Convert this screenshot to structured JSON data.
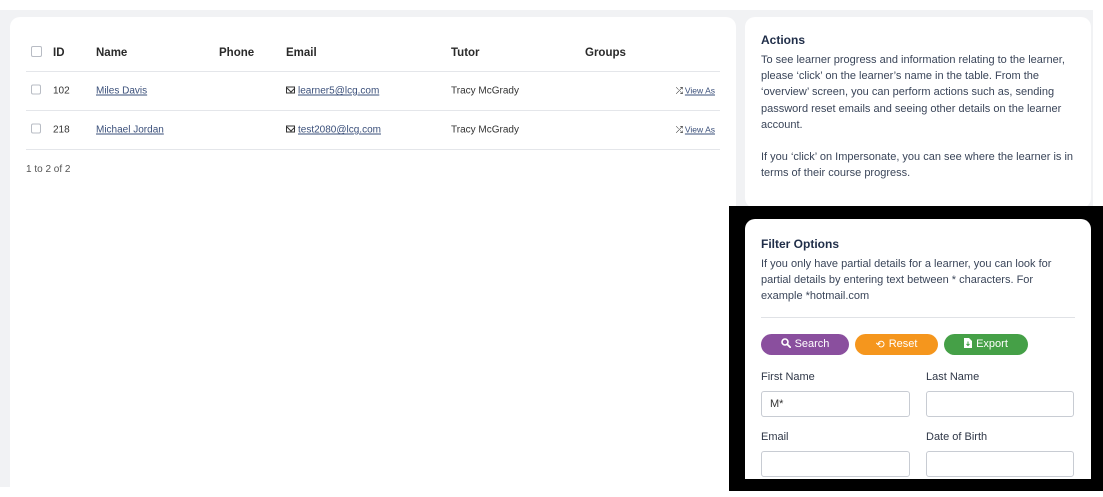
{
  "table": {
    "columns": [
      "ID",
      "Name",
      "Phone",
      "Email",
      "Tutor",
      "Groups"
    ],
    "rows": [
      {
        "id": "102",
        "name": "Miles Davis",
        "phone": "",
        "email": "learner5@lcg.com",
        "tutor": "Tracy McGrady",
        "groups": "",
        "action": "View As"
      },
      {
        "id": "218",
        "name": "Michael Jordan",
        "phone": "",
        "email": "test2080@lcg.com",
        "tutor": "Tracy McGrady",
        "groups": "",
        "action": "View As"
      }
    ],
    "count": "1 to 2 of 2"
  },
  "actions": {
    "title": "Actions",
    "para1": "To see learner progress and information relating to the learner, please ‘click’ on the learner’s name in the table. From the ‘overview’ screen, you can perform actions such as, sending password reset emails and seeing other details on the learner account.",
    "para2": "If you ‘click’ on Impersonate, you can see where the learner is in terms of their course progress."
  },
  "filter": {
    "title": "Filter Options",
    "text": "If you only have partial details for a learner, you can look for partial details by entering text between * characters. For example *hotmail.com",
    "search_label": "Search",
    "reset_label": "Reset",
    "export_label": "Export",
    "fields": {
      "first_name_label": "First Name",
      "first_name_value": "M*",
      "last_name_label": "Last Name",
      "last_name_value": "",
      "email_label": "Email",
      "email_value": "",
      "dob_label": "Date of Birth",
      "dob_value": ""
    }
  },
  "icons": {
    "checkbox": "checkbox-icon",
    "email": "envelope-icon",
    "view_as": "shuffle-icon",
    "search": "search-icon",
    "reset": "refresh-icon",
    "export": "file-export-icon"
  },
  "colors": {
    "search_button": "#8a4f9e",
    "reset_button": "#f5961d",
    "export_button": "#45a047",
    "link": "#3a4f7a",
    "title": "#1f2d48"
  }
}
